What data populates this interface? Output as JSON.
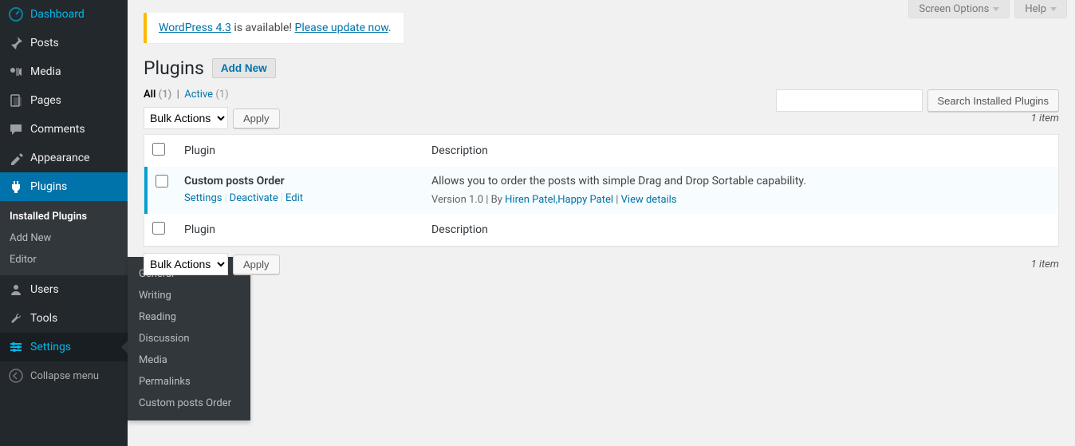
{
  "topButtons": {
    "screenOptions": "Screen Options",
    "help": "Help"
  },
  "sidebar": {
    "items": [
      {
        "label": "Dashboard",
        "icon": "dashboard"
      },
      {
        "label": "Posts",
        "icon": "pin"
      },
      {
        "label": "Media",
        "icon": "media"
      },
      {
        "label": "Pages",
        "icon": "pages"
      },
      {
        "label": "Comments",
        "icon": "comments"
      },
      {
        "label": "Appearance",
        "icon": "appearance"
      },
      {
        "label": "Plugins",
        "icon": "plugins"
      },
      {
        "label": "Users",
        "icon": "users"
      },
      {
        "label": "Tools",
        "icon": "tools"
      },
      {
        "label": "Settings",
        "icon": "settings"
      }
    ],
    "pluginsSubmenu": [
      "Installed Plugins",
      "Add New",
      "Editor"
    ],
    "settingsFlyout": [
      "General",
      "Writing",
      "Reading",
      "Discussion",
      "Media",
      "Permalinks",
      "Custom posts Order"
    ],
    "collapse": "Collapse menu"
  },
  "updateNag": {
    "prefix": "WordPress 4.3",
    "middle": " is available! ",
    "link": "Please update now",
    "suffix": "."
  },
  "page": {
    "title": "Plugins",
    "addNew": "Add New"
  },
  "filters": {
    "allLabel": "All",
    "allCount": "(1)",
    "activeLabel": "Active",
    "activeCount": "(1)"
  },
  "search": {
    "button": "Search Installed Plugins"
  },
  "bulk": {
    "selectLabel": "Bulk Actions",
    "apply": "Apply"
  },
  "itemCount": "1 item",
  "table": {
    "colPlugin": "Plugin",
    "colDescription": "Description"
  },
  "plugin": {
    "name": "Custom posts Order",
    "actions": {
      "settings": "Settings",
      "deactivate": "Deactivate",
      "edit": "Edit"
    },
    "description": "Allows you to order the posts with simple Drag and Drop Sortable capability.",
    "version": "Version 1.0",
    "byLabel": "By",
    "author": "Hiren Patel,Happy Patel",
    "viewDetails": "View details"
  }
}
